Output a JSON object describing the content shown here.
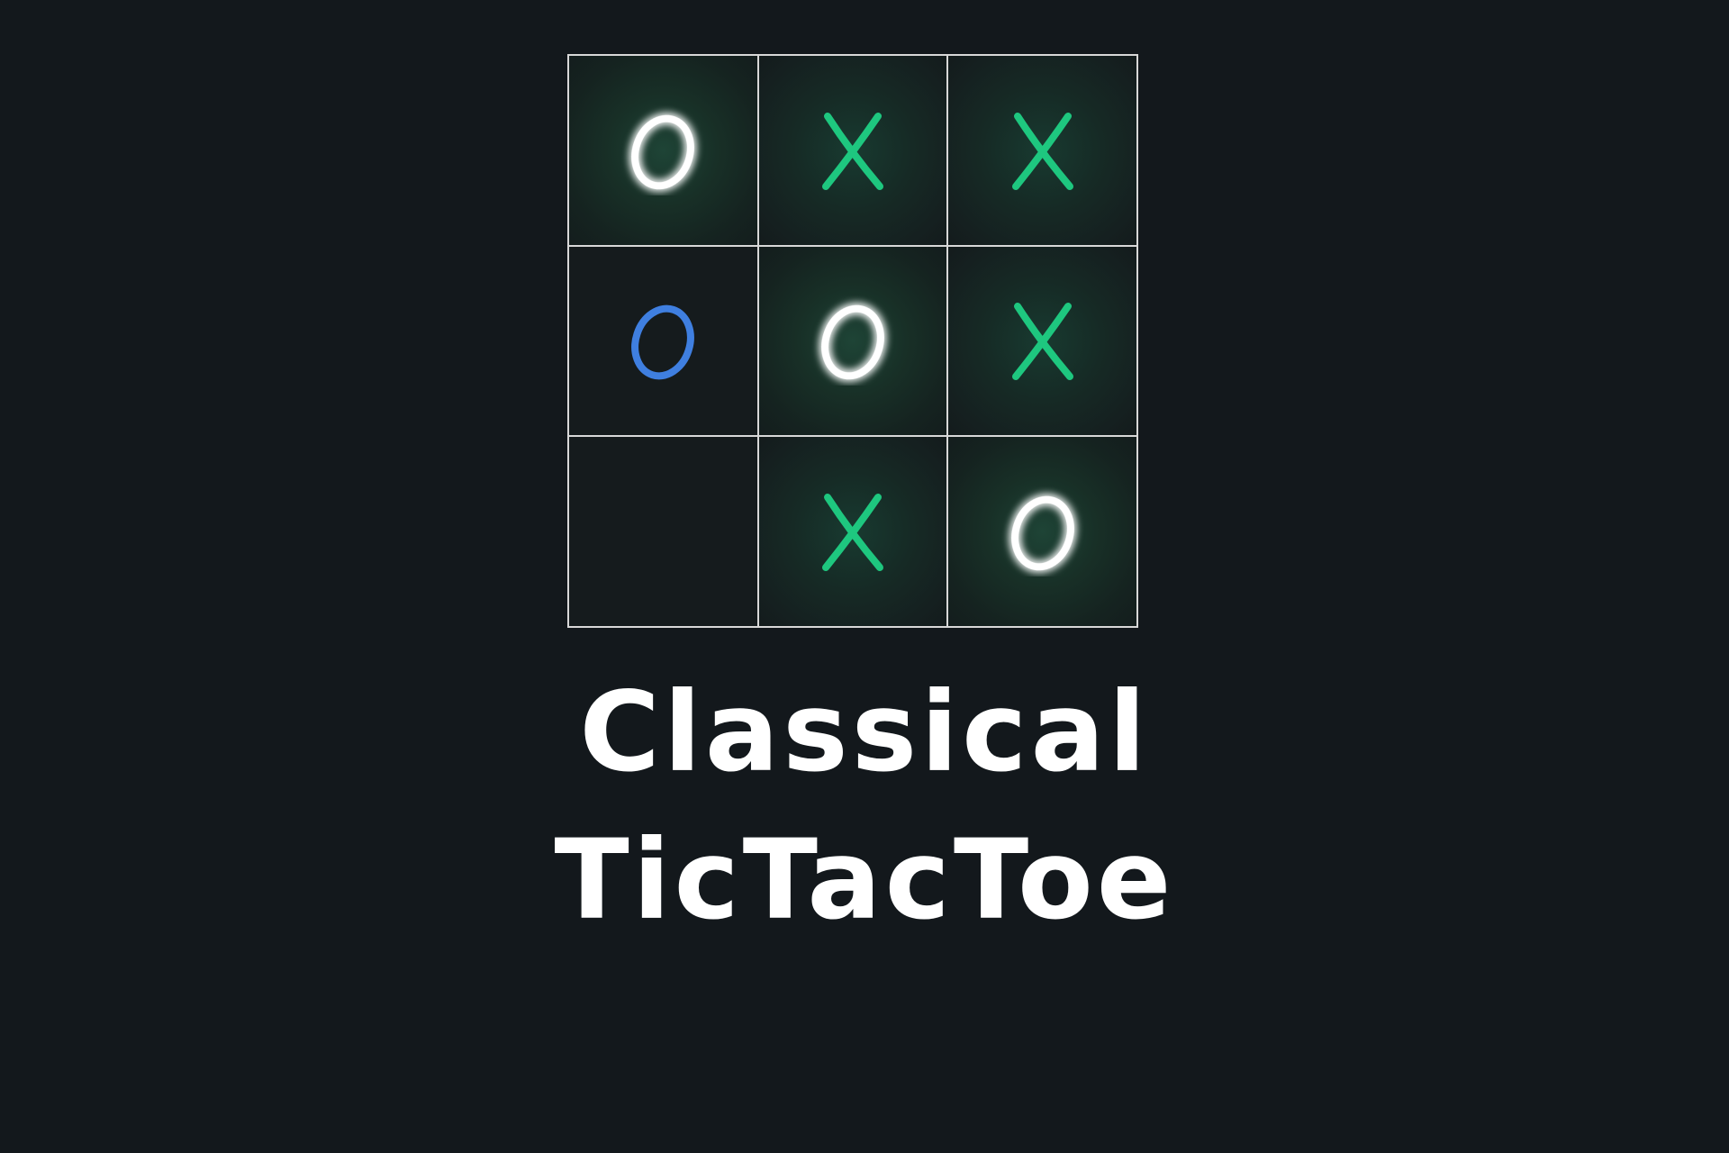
{
  "board": {
    "cells": [
      {
        "mark": "O",
        "color": "#ffffff",
        "glow": true
      },
      {
        "mark": "X",
        "color": "#1ec77f",
        "glow": false
      },
      {
        "mark": "X",
        "color": "#1ec77f",
        "glow": false
      },
      {
        "mark": "O",
        "color": "#3f7fe0",
        "glow": false
      },
      {
        "mark": "O",
        "color": "#ffffff",
        "glow": true
      },
      {
        "mark": "X",
        "color": "#1ec77f",
        "glow": false
      },
      {
        "mark": "",
        "color": "",
        "glow": false
      },
      {
        "mark": "X",
        "color": "#1ec77f",
        "glow": false
      },
      {
        "mark": "O",
        "color": "#ffffff",
        "glow": true
      }
    ],
    "line_color": "#d8d8d8"
  },
  "title": {
    "line1": "Classical",
    "line2": "TicTacToe"
  },
  "colors": {
    "background": "#13181c",
    "x_mark": "#1ec77f",
    "o_mark_blue": "#3f7fe0",
    "o_mark_glow": "#ffffff"
  }
}
